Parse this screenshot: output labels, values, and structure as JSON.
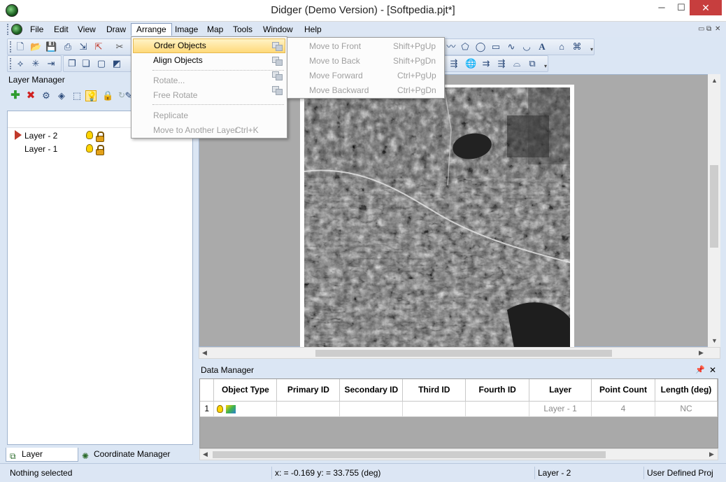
{
  "window": {
    "title": "Didger (Demo Version) - [Softpedia.pjt*]",
    "min": "─",
    "max": "☐",
    "close": "✕"
  },
  "menubar": {
    "items": [
      "File",
      "Edit",
      "View",
      "Draw",
      "Arrange",
      "Image",
      "Map",
      "Tools",
      "Window",
      "Help"
    ],
    "active": "Arrange",
    "mdi_min": "▭",
    "mdi_restore": "⧉",
    "mdi_close": "✕"
  },
  "arrange_menu": {
    "items": [
      {
        "label": "Order Objects",
        "state": "highlighted",
        "submenu": true
      },
      {
        "label": "Align Objects",
        "state": "enabled",
        "submenu": true
      },
      {
        "label": "Rotate...",
        "state": "disabled"
      },
      {
        "label": "Free Rotate",
        "state": "disabled"
      },
      {
        "label": "Replicate",
        "state": "disabled"
      },
      {
        "label": "Move to Another Layer",
        "state": "disabled",
        "shortcut": "Ctrl+K"
      }
    ]
  },
  "order_submenu": {
    "items": [
      {
        "label": "Move to Front",
        "shortcut": "Shift+PgUp",
        "state": "disabled"
      },
      {
        "label": "Move to Back",
        "shortcut": "Shift+PgDn",
        "state": "disabled"
      },
      {
        "label": "Move Forward",
        "shortcut": "Ctrl+PgUp",
        "state": "disabled"
      },
      {
        "label": "Move Backward",
        "shortcut": "Ctrl+PgDn",
        "state": "disabled"
      }
    ]
  },
  "layer_manager": {
    "title": "Layer Manager",
    "layers": [
      {
        "name": "Layer - 2",
        "current": true
      },
      {
        "name": "Layer - 1",
        "current": false
      }
    ],
    "tabs": [
      {
        "label": "Layer Manager",
        "active": true
      },
      {
        "label": "Coordinate Manager",
        "active": false
      }
    ]
  },
  "data_manager": {
    "title": "Data Manager",
    "columns": [
      "Object Type",
      "Primary ID",
      "Secondary ID",
      "Third ID",
      "Fourth ID",
      "Layer",
      "Point Count",
      "Length (deg)"
    ],
    "rows": [
      {
        "num": "1",
        "object_type": "",
        "primary_id": "",
        "secondary_id": "",
        "third_id": "",
        "fourth_id": "",
        "layer": "Layer - 1",
        "point_count": "4",
        "length": "NC"
      }
    ]
  },
  "statusbar": {
    "selection": "Nothing selected",
    "coords": "x: = -0.169 y: = 33.755 (deg)",
    "layer": "Layer - 2",
    "projection": "User Defined Proj"
  },
  "colors": {
    "chrome": "#dce6f4",
    "close_button": "#c73e3e",
    "menu_highlight": "#ffd97a",
    "map_background": "#aaaaaa"
  }
}
